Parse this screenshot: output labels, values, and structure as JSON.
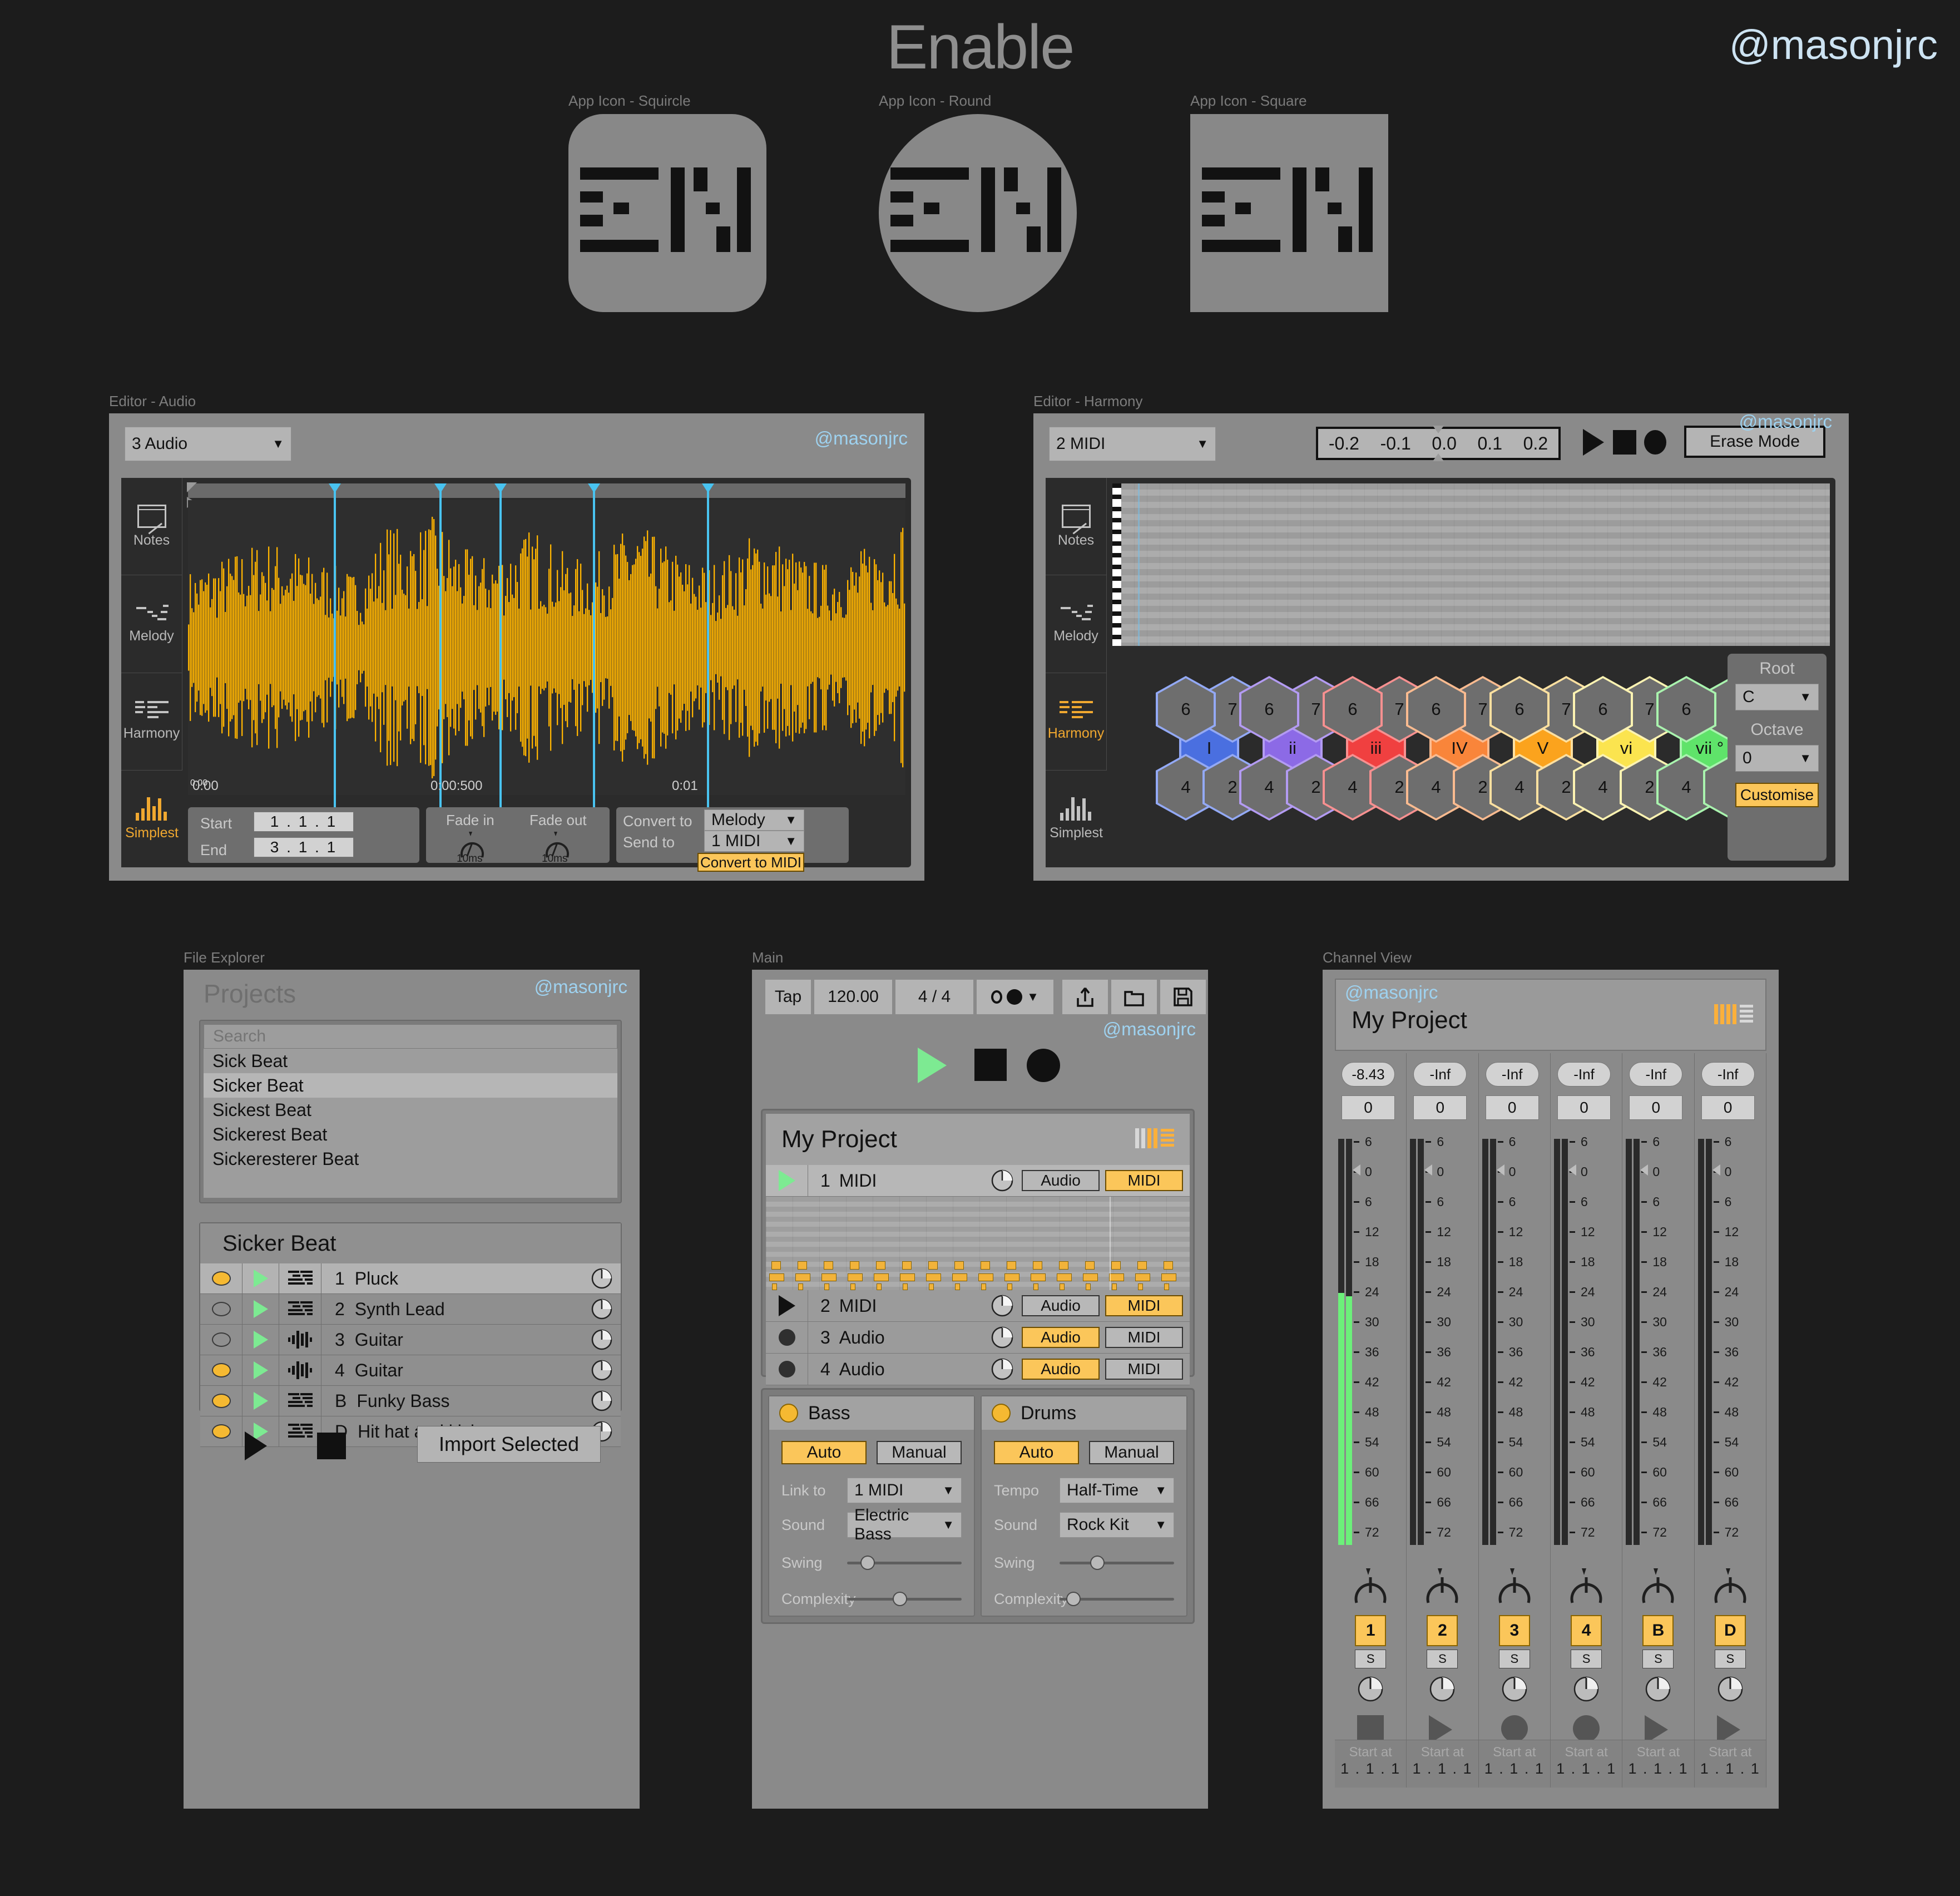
{
  "header": {
    "app_title": "Enable",
    "handle": "@masonjrc",
    "app_icons": [
      {
        "label": "App Icon - Squircle",
        "shape": "squircle"
      },
      {
        "label": "App Icon - Round",
        "shape": "round"
      },
      {
        "label": "App Icon - Square",
        "shape": "square"
      }
    ]
  },
  "editor_audio": {
    "window_label": "Editor - Audio",
    "handle": "@masonjrc",
    "track_select": "3 Audio",
    "sidebar": [
      {
        "label": "Notes",
        "icon": "notes-icon",
        "active": false
      },
      {
        "label": "Melody",
        "icon": "melody-icon",
        "active": false
      },
      {
        "label": "Harmony",
        "icon": "harmony-icon",
        "active": false
      },
      {
        "label": "Simplest",
        "icon": "waveform-icon",
        "active": true
      }
    ],
    "timeline_labels": [
      "0:00",
      "0:00:500",
      "0:01"
    ],
    "start_label": "Start",
    "start_value": "1 .  1 .   1",
    "end_label": "End",
    "end_value": "3 .  1 .   1",
    "fade_in_label": "Fade in",
    "fade_in_value": "10ms",
    "fade_out_label": "Fade out",
    "fade_out_value": "10ms",
    "convert_to_label": "Convert to",
    "convert_to_value": "Melody",
    "send_to_label": "Send to",
    "send_to_value": "1 MIDI",
    "convert_button": "Convert to MIDI"
  },
  "editor_harmony": {
    "window_label": "Editor - Harmony",
    "handle": "@masonjrc",
    "track_select": "2 MIDI",
    "scale_ticks": [
      "-0.2",
      "-0.1",
      "0.0",
      "0.1",
      "0.2"
    ],
    "erase_mode_button": "Erase Mode",
    "transport": [
      "play-icon",
      "stop-icon",
      "record-icon"
    ],
    "sidebar": [
      {
        "label": "Notes",
        "icon": "notes-icon",
        "active": false
      },
      {
        "label": "Melody",
        "icon": "melody-icon",
        "active": false
      },
      {
        "label": "Harmony",
        "icon": "harmony-icon",
        "active": true
      },
      {
        "label": "Simplest",
        "icon": "waveform-icon",
        "active": false
      }
    ],
    "chords": [
      {
        "numeral": "I",
        "color": "#4a6fe0",
        "glow": "#93a9f5",
        "ext": [
          "7",
          "6",
          "4",
          "2"
        ]
      },
      {
        "numeral": "ii",
        "color": "#8c6ae6",
        "glow": "#b39bf2",
        "ext": [
          "7",
          "6",
          "4",
          "2"
        ]
      },
      {
        "numeral": "iii",
        "color": "#f04040",
        "glow": "#f79090",
        "ext": [
          "7",
          "6",
          "4",
          "2"
        ]
      },
      {
        "numeral": "IV",
        "color": "#f9853a",
        "glow": "#fbbb90",
        "ext": [
          "7",
          "6",
          "4",
          "2"
        ]
      },
      {
        "numeral": "V",
        "color": "#fba31d",
        "glow": "#fde0a0",
        "ext": [
          "7",
          "6",
          "4",
          "2"
        ]
      },
      {
        "numeral": "vi",
        "color": "#fbe44f",
        "glow": "#fdf3b2",
        "ext": [
          "7",
          "6",
          "4",
          "2"
        ]
      },
      {
        "numeral": "vii °",
        "color": "#5fe36a",
        "glow": "#a9f3ae",
        "ext": [
          "7",
          "6",
          "4",
          "2"
        ]
      }
    ],
    "root_label": "Root",
    "root_value": "C",
    "octave_label": "Octave",
    "octave_value": "0",
    "customise_button": "Customise"
  },
  "file_explorer": {
    "window_label": "File Explorer",
    "handle": "@masonjrc",
    "title": "Projects",
    "search_placeholder": "Search",
    "projects": [
      "Sick Beat",
      "Sicker Beat",
      "Sickest Beat",
      "Sickerest Beat",
      "Sickeresterer Beat"
    ],
    "selected_project": "Sicker Beat",
    "detail_title": "Sicker Beat",
    "tracks": [
      {
        "enabled": true,
        "type": "midi",
        "num": "1",
        "name": "Pluck",
        "selected": true
      },
      {
        "enabled": false,
        "type": "midi",
        "num": "2",
        "name": "Synth Lead",
        "selected": false
      },
      {
        "enabled": false,
        "type": "audio",
        "num": "3",
        "name": "Guitar",
        "selected": false
      },
      {
        "enabled": true,
        "type": "audio",
        "num": "4",
        "name": "Guitar",
        "selected": false
      },
      {
        "enabled": true,
        "type": "midi",
        "num": "B",
        "name": "Funky Bass",
        "selected": false
      },
      {
        "enabled": true,
        "type": "midi",
        "num": "D",
        "name": "Hit hat and kick",
        "selected": false
      }
    ],
    "import_button": "Import Selected"
  },
  "main": {
    "window_label": "Main",
    "handle": "@masonjrc",
    "toolbar": {
      "tap_label": "Tap",
      "tempo_value": "120.00",
      "time_signature": "4 / 4",
      "metronome_icon": "metronome-icon",
      "export_icon": "export-icon",
      "folder_icon": "folder-icon",
      "save_icon": "save-icon"
    },
    "transport": [
      "play-icon",
      "stop-icon",
      "record-icon"
    ],
    "project_title": "My Project",
    "view_toggle_icon": "channel-list-view-icon",
    "tracks": [
      {
        "num": "1",
        "name": "MIDI",
        "state": "play",
        "audio": false,
        "midi": true,
        "selected": true
      },
      {
        "num": "2",
        "name": "MIDI",
        "state": "play",
        "audio": false,
        "midi": true,
        "selected": false
      },
      {
        "num": "3",
        "name": "Audio",
        "state": "record",
        "audio": true,
        "midi": false,
        "selected": false
      },
      {
        "num": "4",
        "name": "Audio",
        "state": "record",
        "audio": true,
        "midi": false,
        "selected": false
      }
    ],
    "audio_label": "Audio",
    "midi_label": "MIDI",
    "generators": [
      {
        "name": "Bass",
        "mode_auto": "Auto",
        "mode_manual": "Manual",
        "active_mode": "Auto",
        "row1_label": "Link to",
        "row1_value": "1 MIDI",
        "row2_label": "Sound",
        "row2_value": "Electric Bass",
        "swing_label": "Swing",
        "swing_pct": 18,
        "complexity_label": "Complexity",
        "complexity_pct": 46
      },
      {
        "name": "Drums",
        "mode_auto": "Auto",
        "mode_manual": "Manual",
        "active_mode": "Auto",
        "row1_label": "Tempo",
        "row1_value": "Half-Time",
        "row2_label": "Sound",
        "row2_value": "Rock Kit",
        "swing_label": "Swing",
        "swing_pct": 33,
        "complexity_label": "Complexity",
        "complexity_pct": 12
      }
    ]
  },
  "channel_view": {
    "window_label": "Channel View",
    "handle": "@masonjrc",
    "project_title": "My Project",
    "view_toggle_icon": "channel-list-view-icon",
    "meter_scale": [
      "6",
      "0",
      "6",
      "12",
      "18",
      "24",
      "30",
      "36",
      "42",
      "48",
      "54",
      "60",
      "66",
      "72"
    ],
    "solo_label": "S",
    "start_at_label": "Start at",
    "start_at_value": "1 . 1 . 1",
    "channels": [
      {
        "db": "-8.43",
        "pan": "0",
        "id": "1",
        "state": "stop",
        "level_pct": 62,
        "active": true
      },
      {
        "db": "-Inf",
        "pan": "0",
        "id": "2",
        "state": "play",
        "level_pct": 0,
        "active": false
      },
      {
        "db": "-Inf",
        "pan": "0",
        "id": "3",
        "state": "record",
        "level_pct": 0,
        "active": false
      },
      {
        "db": "-Inf",
        "pan": "0",
        "id": "4",
        "state": "record",
        "level_pct": 0,
        "active": false
      },
      {
        "db": "-Inf",
        "pan": "0",
        "id": "B",
        "state": "play",
        "level_pct": 0,
        "active": false
      },
      {
        "db": "-Inf",
        "pan": "0",
        "id": "D",
        "state": "play",
        "level_pct": 0,
        "active": false
      }
    ]
  },
  "colors": {
    "accent": "#fbc65a",
    "waveform": "#ffb400",
    "marker": "#49c3f0",
    "green": "#7dea92",
    "handle_blue": "#cde3f2",
    "bg": "#1c1c1c",
    "panel": "#8a8a8a"
  }
}
